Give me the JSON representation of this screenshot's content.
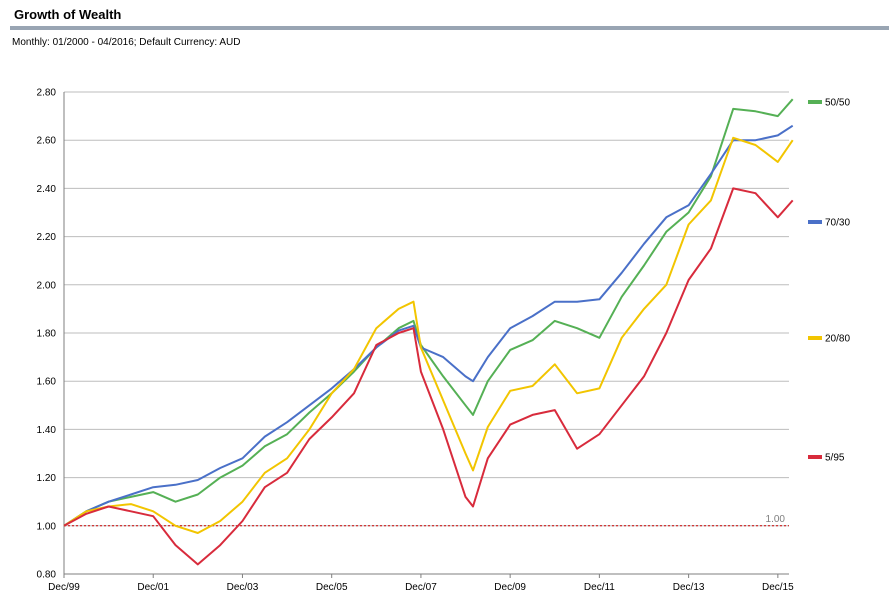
{
  "header": {
    "title": "Growth of Wealth",
    "subtitle": "Monthly: 01/2000 - 04/2016; Default Currency: AUD"
  },
  "chart_data": {
    "type": "line",
    "title": "Growth of Wealth",
    "subtitle": "Monthly: 01/2000 - 04/2016; Default Currency: AUD",
    "xlabel": "",
    "ylabel": "",
    "ylim": [
      0.8,
      2.8
    ],
    "yticks": [
      "0.80",
      "1.00",
      "1.20",
      "1.40",
      "1.60",
      "1.80",
      "2.00",
      "2.20",
      "2.40",
      "2.60",
      "2.80"
    ],
    "xticks": [
      "Dec/99",
      "Dec/01",
      "Dec/03",
      "Dec/05",
      "Dec/07",
      "Dec/09",
      "Dec/11",
      "Dec/13",
      "Dec/15"
    ],
    "grid": true,
    "legend_position": "right",
    "reference_line": {
      "value": 1.0,
      "label": "1.00",
      "color": "#cc0000"
    },
    "x": [
      "Dec/99",
      "Jun/00",
      "Dec/00",
      "Jun/01",
      "Dec/01",
      "Jun/02",
      "Dec/02",
      "Jun/03",
      "Dec/03",
      "Jun/04",
      "Dec/04",
      "Jun/05",
      "Dec/05",
      "Jun/06",
      "Dec/06",
      "Jun/07",
      "Oct/07",
      "Dec/07",
      "Jun/08",
      "Dec/08",
      "Feb/09",
      "Jun/09",
      "Dec/09",
      "Jun/10",
      "Dec/10",
      "Jun/11",
      "Dec/11",
      "Jun/12",
      "Dec/12",
      "Jun/13",
      "Dec/13",
      "Jun/14",
      "Dec/14",
      "Jun/15",
      "Dec/15",
      "Apr/16"
    ],
    "series": [
      {
        "name": "50/50",
        "color": "#55b055",
        "values": [
          1.0,
          1.06,
          1.1,
          1.12,
          1.14,
          1.1,
          1.13,
          1.2,
          1.25,
          1.33,
          1.38,
          1.47,
          1.55,
          1.64,
          1.74,
          1.82,
          1.85,
          1.75,
          1.62,
          1.5,
          1.46,
          1.6,
          1.73,
          1.77,
          1.85,
          1.82,
          1.78,
          1.95,
          2.08,
          2.22,
          2.3,
          2.45,
          2.73,
          2.72,
          2.7,
          2.77
        ]
      },
      {
        "name": "70/30",
        "color": "#4a70c8",
        "values": [
          1.0,
          1.06,
          1.1,
          1.13,
          1.16,
          1.17,
          1.19,
          1.24,
          1.28,
          1.37,
          1.43,
          1.5,
          1.57,
          1.65,
          1.74,
          1.81,
          1.83,
          1.74,
          1.7,
          1.62,
          1.6,
          1.7,
          1.82,
          1.87,
          1.93,
          1.93,
          1.94,
          2.05,
          2.17,
          2.28,
          2.33,
          2.46,
          2.6,
          2.6,
          2.62,
          2.66
        ]
      },
      {
        "name": "20/80",
        "color": "#f2c500",
        "values": [
          1.0,
          1.06,
          1.08,
          1.09,
          1.06,
          1.0,
          0.97,
          1.02,
          1.1,
          1.22,
          1.28,
          1.4,
          1.55,
          1.65,
          1.82,
          1.9,
          1.93,
          1.74,
          1.52,
          1.3,
          1.23,
          1.41,
          1.56,
          1.58,
          1.67,
          1.55,
          1.57,
          1.78,
          1.9,
          2.0,
          2.25,
          2.35,
          2.61,
          2.58,
          2.51,
          2.6
        ]
      },
      {
        "name": "5/95",
        "color": "#d82b3c",
        "values": [
          1.0,
          1.05,
          1.08,
          1.06,
          1.04,
          0.92,
          0.84,
          0.92,
          1.02,
          1.16,
          1.22,
          1.36,
          1.45,
          1.55,
          1.75,
          1.8,
          1.82,
          1.64,
          1.4,
          1.12,
          1.08,
          1.28,
          1.42,
          1.46,
          1.48,
          1.32,
          1.38,
          1.5,
          1.62,
          1.8,
          2.02,
          2.15,
          2.4,
          2.38,
          2.28,
          2.35
        ]
      }
    ]
  }
}
